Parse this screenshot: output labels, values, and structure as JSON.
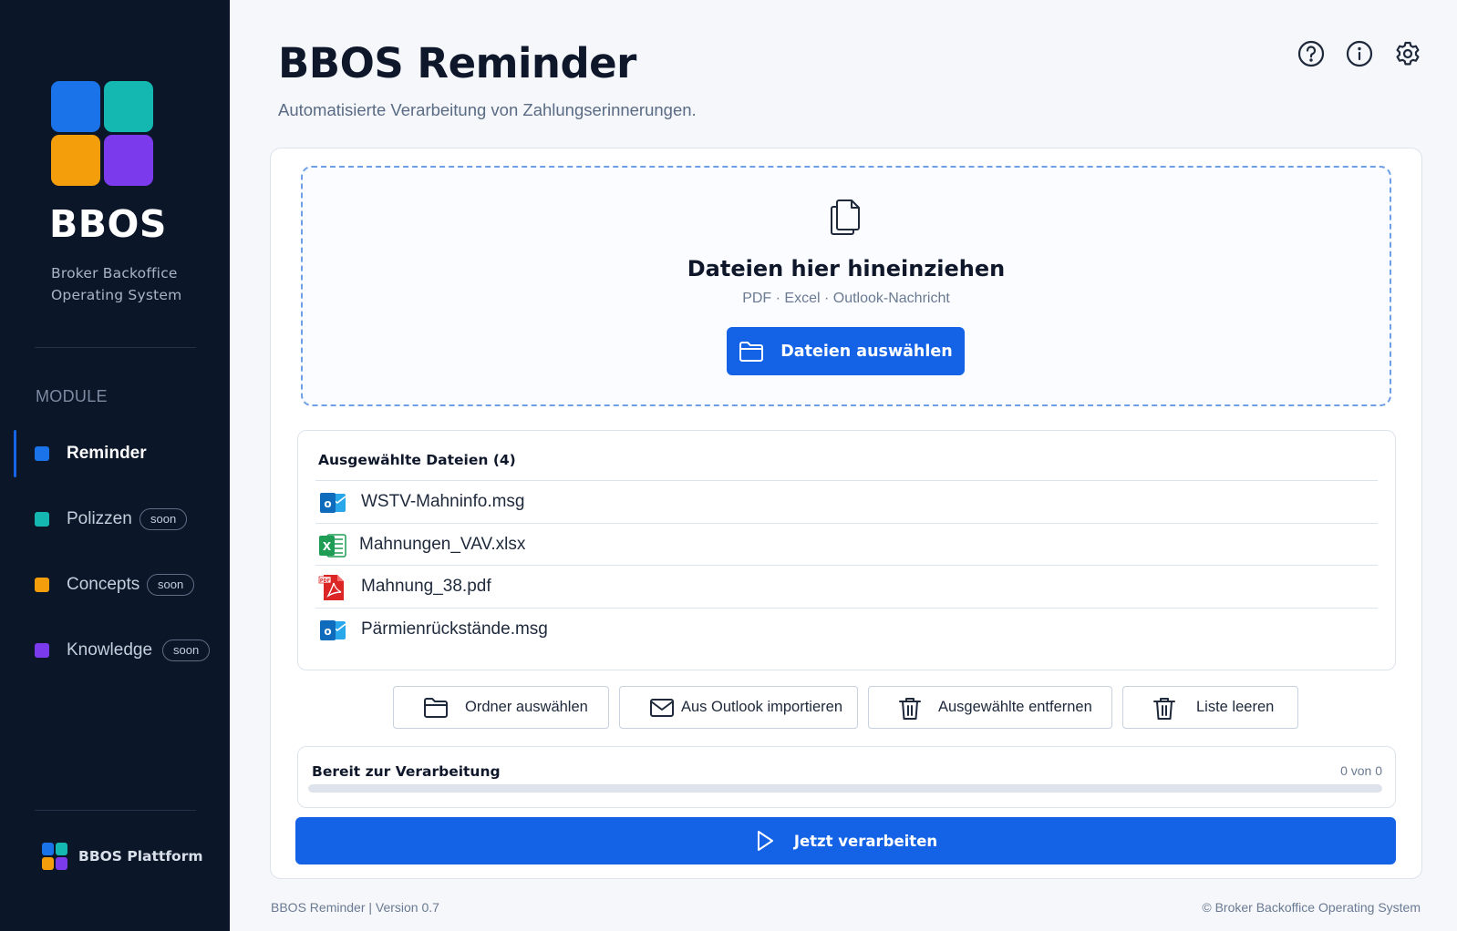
{
  "colors": {
    "sidebar_bg": "#0b1629",
    "accent": "#1463e6",
    "logo_blue": "#1a73e8",
    "logo_teal": "#14b8b0",
    "logo_orange": "#f59e0b",
    "logo_purple": "#7c3aed",
    "excel_green": "#1f9d55",
    "pdf_red": "#dc2626",
    "outlook_blue": "#0f6cbd"
  },
  "sidebar": {
    "brand": "BBOS",
    "brand_sub_line1": "Broker Backoffice",
    "brand_sub_line2": "Operating System",
    "section_label": "MODULE",
    "items": [
      {
        "label": "Reminder",
        "badge": "",
        "active": true,
        "color": "#1a73e8"
      },
      {
        "label": "Polizzen",
        "badge": "soon",
        "active": false,
        "color": "#14b8b0"
      },
      {
        "label": "Concepts",
        "badge": "soon",
        "active": false,
        "color": "#f59e0b"
      },
      {
        "label": "Knowledge",
        "badge": "soon",
        "active": false,
        "color": "#7c3aed"
      }
    ],
    "platform_label": "BBOS Plattform"
  },
  "header": {
    "title": "BBOS Reminder",
    "subtitle": "Automatisierte Verarbeitung von Zahlungserinnerungen.",
    "icons": [
      "help-icon",
      "info-icon",
      "gear-icon"
    ]
  },
  "dropzone": {
    "icon": "files-icon",
    "title": "Dateien hier hineinziehen",
    "subtitle": "PDF · Excel · Outlook-Nachricht",
    "button_label": "Dateien auswählen"
  },
  "files": {
    "heading": "Ausgewählte Dateien (4)",
    "items": [
      {
        "name": "WSTV-Mahninfo.msg",
        "type": "outlook"
      },
      {
        "name": "Mahnungen_VAV.xlsx",
        "type": "excel"
      },
      {
        "name": "Mahnung_38.pdf",
        "type": "pdf"
      },
      {
        "name": "Pärmienrückstände.msg",
        "type": "outlook"
      }
    ]
  },
  "actions": {
    "folder": "Ordner auswählen",
    "outlook": "Aus Outlook importieren",
    "remove": "Ausgewählte entfernen",
    "clear": "Liste leeren"
  },
  "progress": {
    "label": "Bereit zur Verarbeitung",
    "count": "0 von 0",
    "fraction": 0
  },
  "run_button_label": "Jetzt verarbeiten",
  "footer": {
    "left": "BBOS Reminder | Version 0.7",
    "right": "© Broker Backoffice Operating System"
  }
}
